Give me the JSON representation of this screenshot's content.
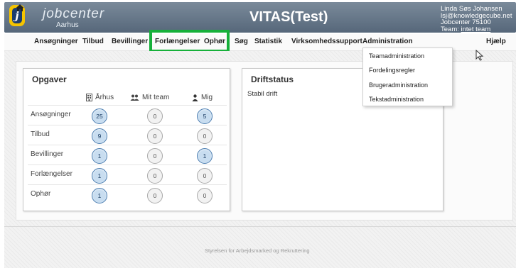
{
  "header": {
    "logo_text": "jobcenter",
    "logo_city": "Aarhus",
    "logo_letter": "j",
    "app_title": "VITAS(Test)",
    "user": {
      "name": "Linda Søs Johansen",
      "email": "lsj@knowledgecube.net",
      "org": "Jobcenter 75100",
      "team_prefix": "Team:",
      "team_link": "intet team"
    }
  },
  "nav": {
    "home_icon": "home-icon",
    "items": [
      {
        "label": "Ansøgninger"
      },
      {
        "label": "Tilbud"
      },
      {
        "label": "Bevillinger"
      },
      {
        "label": "Forlængelser"
      },
      {
        "label": "Ophør"
      },
      {
        "label": "Søg"
      },
      {
        "label": "Statistik"
      },
      {
        "label": "Virksomhedssupport"
      },
      {
        "label": "Administration"
      }
    ],
    "help": "Hjælp"
  },
  "admin_dropdown": {
    "items": [
      {
        "label": "Teamadministration"
      },
      {
        "label": "Fordelingsregler"
      },
      {
        "label": "Brugeradministration"
      },
      {
        "label": "Tekstadministration"
      }
    ]
  },
  "opgaver": {
    "title": "Opgaver",
    "columns": [
      {
        "label": "Århus",
        "icon": "building-icon"
      },
      {
        "label": "Mit team",
        "icon": "team-icon"
      },
      {
        "label": "Mig",
        "icon": "person-icon"
      }
    ],
    "rows": [
      {
        "label": "Ansøgninger",
        "values": [
          "25",
          "0",
          "5"
        ],
        "highlight": [
          true,
          false,
          true
        ]
      },
      {
        "label": "Tilbud",
        "values": [
          "9",
          "0",
          "0"
        ],
        "highlight": [
          true,
          false,
          false
        ]
      },
      {
        "label": "Bevillinger",
        "values": [
          "1",
          "0",
          "1"
        ],
        "highlight": [
          true,
          false,
          true
        ]
      },
      {
        "label": "Forlængelser",
        "values": [
          "1",
          "0",
          "0"
        ],
        "highlight": [
          true,
          false,
          false
        ]
      },
      {
        "label": "Ophør",
        "values": [
          "1",
          "0",
          "0"
        ],
        "highlight": [
          true,
          false,
          false
        ]
      }
    ]
  },
  "driftstatus": {
    "title": "Driftstatus",
    "text": "Stabil drift"
  },
  "footer": {
    "text": "Styrelsen for Arbejdsmarked og Rekruttering"
  },
  "colors": {
    "header_bg": "#56677a",
    "highlight_box": "#16b03a",
    "badge_active": "#c8ddf0",
    "badge_active_border": "#4b7db0",
    "logo_yellow": "#f5c400",
    "logo_navy": "#1b3c6e"
  }
}
